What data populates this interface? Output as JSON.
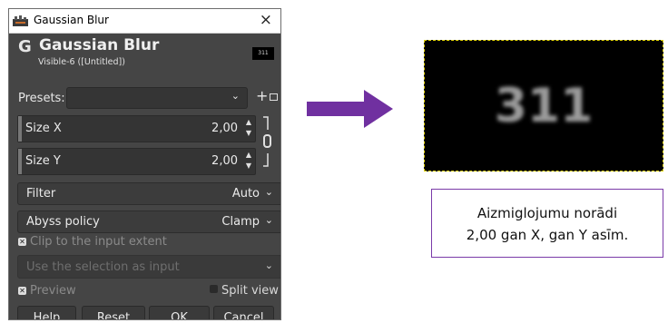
{
  "dialog": {
    "window_title": "Gaussian Blur",
    "close_glyph": "×",
    "header_title": "Gaussian Blur",
    "header_subtitle": "Visible-6 ([Untitled])",
    "thumb_text": "311",
    "presets_label": "Presets:",
    "presets_value": "",
    "size_x": {
      "label": "Size X",
      "value": "2,00"
    },
    "size_y": {
      "label": "Size Y",
      "value": "2,00"
    },
    "filter": {
      "label": "Filter",
      "value": "Auto"
    },
    "abyss": {
      "label": "Abyss policy",
      "value": "Clamp"
    },
    "clip_label": "Clip to the input extent",
    "selection_input_label": "Use the selection as input",
    "preview_label": "Preview",
    "split_view_label": "Split view",
    "buttons": {
      "help": "Help",
      "reset": "Reset",
      "ok": "OK",
      "cancel": "Cancel"
    },
    "icons": {
      "app": "gimp-icon",
      "header": "gegl-icon",
      "chain": "chain-link-icon"
    }
  },
  "preview": {
    "number": "311"
  },
  "note": {
    "line1": "Aizmiglojumu norādi",
    "line2": "2,00 gan X, gan Y asīm."
  },
  "colors": {
    "arrow": "#7030a0",
    "marching_ants": "#e2d400",
    "dialog_bg": "#454545"
  }
}
